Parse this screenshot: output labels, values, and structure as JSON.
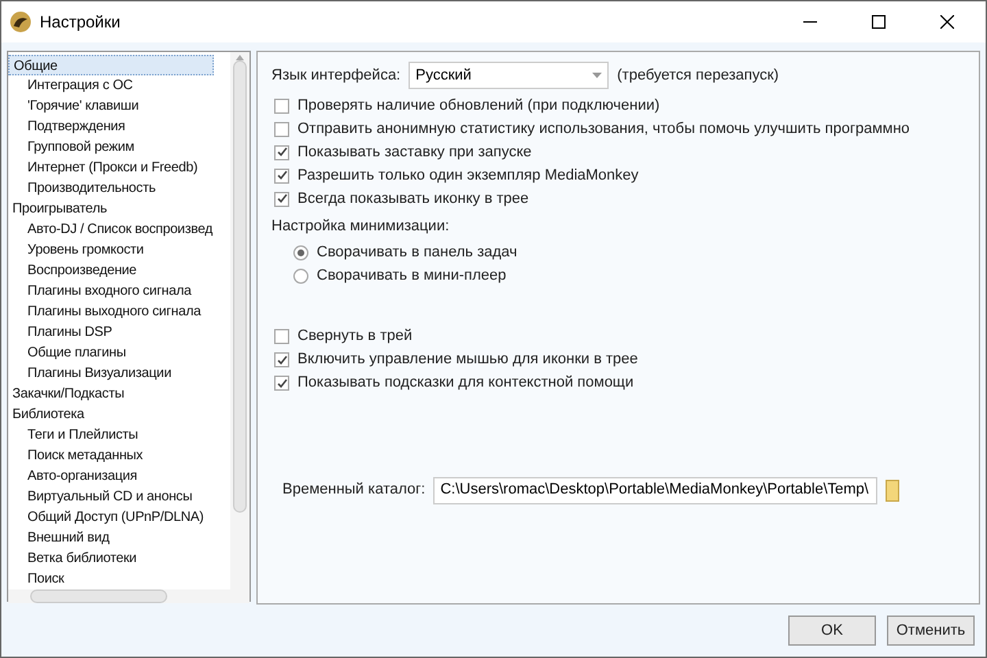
{
  "window": {
    "title": "Настройки"
  },
  "tree": [
    {
      "label": "Общие",
      "selected": true,
      "children": [
        {
          "label": "Интеграция с ОС",
          "selected": false
        },
        {
          "label": "'Горячие' клавиши",
          "selected": false
        },
        {
          "label": "Подтверждения",
          "selected": false
        },
        {
          "label": "Групповой режим",
          "selected": false
        },
        {
          "label": "Интернет (Прокси и Freedb)",
          "selected": false
        },
        {
          "label": "Производительность",
          "selected": false
        }
      ]
    },
    {
      "label": "Проигрыватель",
      "selected": false,
      "children": [
        {
          "label": "Авто-DJ / Список воспроизвед",
          "selected": false
        },
        {
          "label": "Уровень громкости",
          "selected": false
        },
        {
          "label": "Воспроизведение",
          "selected": false
        },
        {
          "label": "Плагины входного сигнала",
          "selected": false
        },
        {
          "label": "Плагины выходного сигнала",
          "selected": false
        },
        {
          "label": "Плагины DSP",
          "selected": false
        },
        {
          "label": "Общие плагины",
          "selected": false
        },
        {
          "label": "Плагины Визуализации",
          "selected": false
        }
      ]
    },
    {
      "label": "Закачки/Подкасты",
      "selected": false
    },
    {
      "label": "Библиотека",
      "selected": false,
      "children": [
        {
          "label": "Теги и Плейлисты",
          "selected": false
        },
        {
          "label": "Поиск метаданных",
          "selected": false
        },
        {
          "label": "Авто-организация",
          "selected": false
        },
        {
          "label": "Виртуальный CD и анонсы",
          "selected": false
        },
        {
          "label": "Общий Доступ (UPnP/DLNA)",
          "selected": false
        },
        {
          "label": "Внешний вид",
          "selected": false
        },
        {
          "label": "Ветка библиотеки",
          "selected": false
        },
        {
          "label": "Поиск",
          "selected": false
        }
      ]
    }
  ],
  "language": {
    "label": "Язык интерфейса:",
    "value": "Русский",
    "note": "(требуется перезапуск)"
  },
  "options": [
    {
      "label": "Проверять наличие обновлений (при подключении)",
      "checked": false
    },
    {
      "label": "Отправить анонимную статистику использования, чтобы помочь улучшить программно",
      "checked": false
    },
    {
      "label": "Показывать заставку при запуске",
      "checked": true
    },
    {
      "label": "Разрешить только один экземпляр MediaMonkey",
      "checked": true
    },
    {
      "label": "Всегда показывать иконку в трее",
      "checked": true
    }
  ],
  "minimize": {
    "label": "Настройка минимизации:",
    "choices": [
      {
        "label": "Сворачивать в панель задач",
        "selected": true
      },
      {
        "label": "Сворачивать в мини-плеер",
        "selected": false
      }
    ]
  },
  "options_2": [
    {
      "label": "Свернуть в трей",
      "checked": false
    },
    {
      "label": "Включить управление мышью для иконки в трее",
      "checked": true
    },
    {
      "label": "Показывать подсказки для контекстной помощи",
      "checked": true
    }
  ],
  "temp_folder": {
    "label": "Временный каталог:",
    "value": "C:\\Users\\romac\\Desktop\\Portable\\MediaMonkey\\Portable\\Temp\\"
  },
  "buttons": [
    "OK",
    "Отменить"
  ]
}
